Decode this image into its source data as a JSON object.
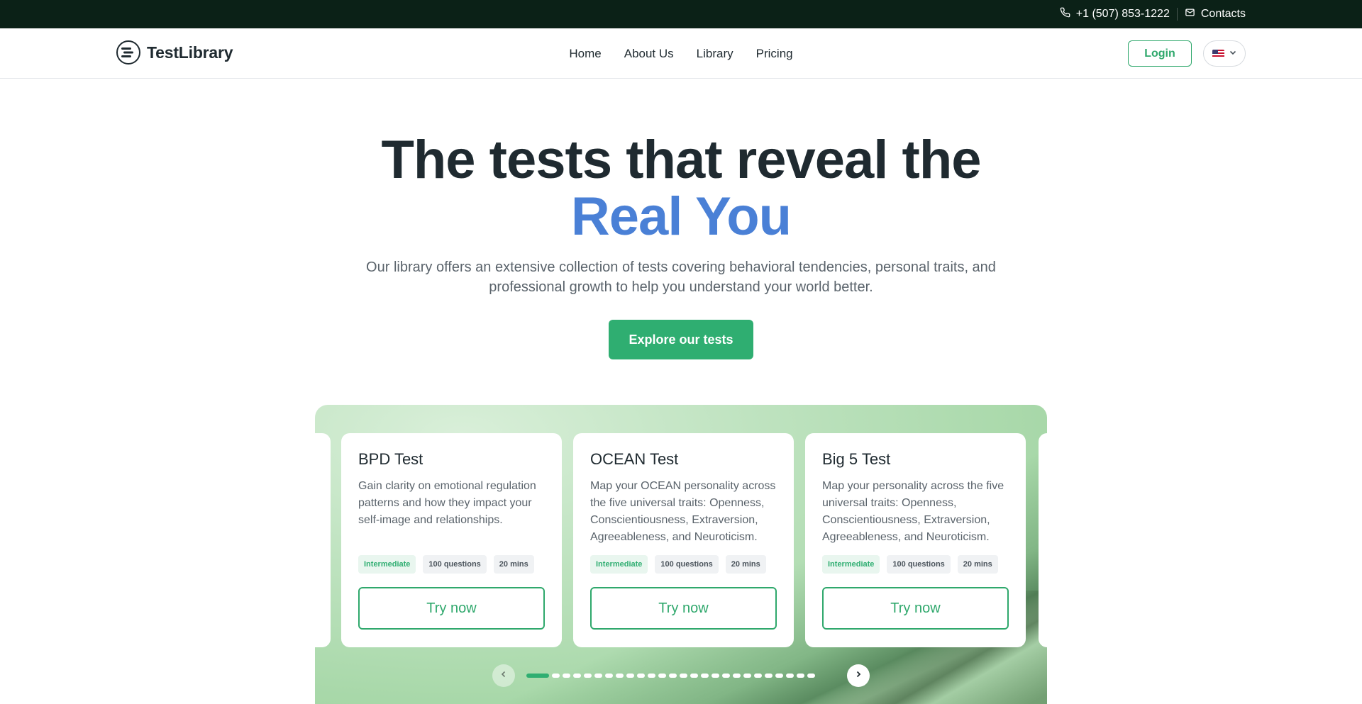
{
  "topbar": {
    "phone": "+1 (507) 853-1222",
    "contacts": "Contacts",
    "phone_icon": "phone-icon",
    "mail_icon": "mail-icon"
  },
  "header": {
    "logo_text": "TestLibrary",
    "nav": [
      "Home",
      "About Us",
      "Library",
      "Pricing"
    ],
    "login_label": "Login",
    "language_flag": "us-flag-icon"
  },
  "hero": {
    "title_line1": "The tests that reveal the",
    "title_line2": "Real You",
    "subtitle": "Our library offers an extensive collection of tests covering behavioral tendencies, personal traits, and professional growth to help you understand your world better.",
    "cta_label": "Explore our tests"
  },
  "carousel": {
    "cards": [
      {
        "title": "BPD Test",
        "description": "Gain clarity on emotional regulation patterns and how they impact your self-image and relationships.",
        "level": "Intermediate",
        "questions": "100 questions",
        "duration": "20 mins",
        "button": "Try now"
      },
      {
        "title": "OCEAN Test",
        "description": "Map your OCEAN personality across the five universal traits: Openness, Conscientiousness, Extraversion, Agreeableness, and Neuroticism.",
        "level": "Intermediate",
        "questions": "100 questions",
        "duration": "20 mins",
        "button": "Try now"
      },
      {
        "title": "Big 5 Test",
        "description": "Map your personality across the five universal traits: Openness, Conscientiousness, Extraversion, Agreeableness, and Neuroticism.",
        "level": "Intermediate",
        "questions": "100 questions",
        "duration": "20 mins",
        "button": "Try now"
      }
    ],
    "page_count": 26,
    "active_page": 1
  },
  "colors": {
    "accent_green": "#2fae71",
    "accent_blue": "#4a80d6",
    "topbar_bg": "#0b2117"
  }
}
